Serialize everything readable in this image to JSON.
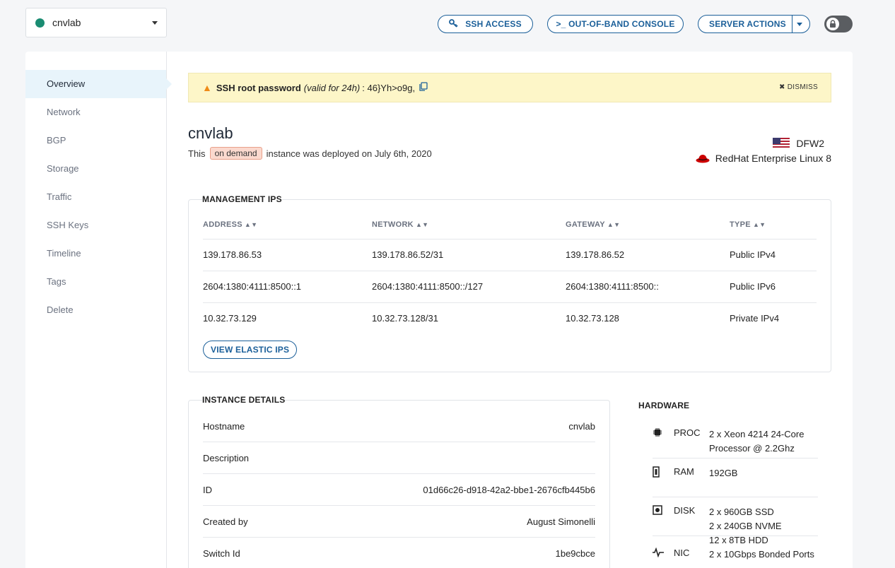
{
  "selector": {
    "name": "cnvlab",
    "status_color": "#1a8c72"
  },
  "toolbar": {
    "ssh_access": "SSH ACCESS",
    "oob_console": ">_ OUT-OF-BAND CONSOLE",
    "server_actions": "SERVER ACTIONS"
  },
  "sidebar": {
    "items": [
      {
        "label": "Overview"
      },
      {
        "label": "Network"
      },
      {
        "label": "BGP"
      },
      {
        "label": "Storage"
      },
      {
        "label": "Traffic"
      },
      {
        "label": "SSH Keys"
      },
      {
        "label": "Timeline"
      },
      {
        "label": "Tags"
      },
      {
        "label": "Delete"
      }
    ]
  },
  "alert": {
    "label": "SSH root password",
    "validity": "(valid for 24h)",
    "password": ": 46}Yh>o9g,",
    "dismiss": "DISMISS"
  },
  "instance": {
    "title": "cnvlab",
    "prefix": "This",
    "badge": "on demand",
    "suffix": "instance was deployed on July 6th, 2020",
    "location": "DFW2",
    "os": "RedHat Enterprise Linux 8"
  },
  "mgmt": {
    "title": "MANAGEMENT IPS",
    "headers": [
      "ADDRESS",
      "NETWORK",
      "GATEWAY",
      "TYPE"
    ],
    "rows": [
      [
        "139.178.86.53",
        "139.178.86.52/31",
        "139.178.86.52",
        "Public IPv4"
      ],
      [
        "2604:1380:4111:8500::1",
        "2604:1380:4111:8500::/127",
        "2604:1380:4111:8500::",
        "Public IPv6"
      ],
      [
        "10.32.73.129",
        "10.32.73.128/31",
        "10.32.73.128",
        "Private IPv4"
      ]
    ],
    "view_elastic": "VIEW ELASTIC IPS"
  },
  "details": {
    "title": "INSTANCE DETAILS",
    "rows": [
      {
        "label": "Hostname",
        "value": "cnvlab"
      },
      {
        "label": "Description",
        "value": ""
      },
      {
        "label": "ID",
        "value": "01d66c26-d918-42a2-bbe1-2676cfb445b6"
      },
      {
        "label": "Created by",
        "value": "August Simonelli"
      },
      {
        "label": "Switch Id",
        "value": "1be9cbce"
      }
    ]
  },
  "hardware": {
    "title": "HARDWARE",
    "proc_label": "PROC",
    "proc_value": "2 x Xeon 4214 24-Core Processor @ 2.2Ghz",
    "ram_label": "RAM",
    "ram_value": "192GB",
    "disk_label": "DISK",
    "disk_1": "2 x 960GB SSD",
    "disk_2": "2 x 240GB NVME",
    "disk_3": "12 x 8TB HDD",
    "nic_label": "NIC",
    "nic_value": "2 x 10Gbps Bonded Ports"
  },
  "colors": {
    "accent": "#1b5f99",
    "alert_bg": "#fdf6c8",
    "warn": "#ef8a17",
    "badge_bg": "#fbd9ce"
  }
}
